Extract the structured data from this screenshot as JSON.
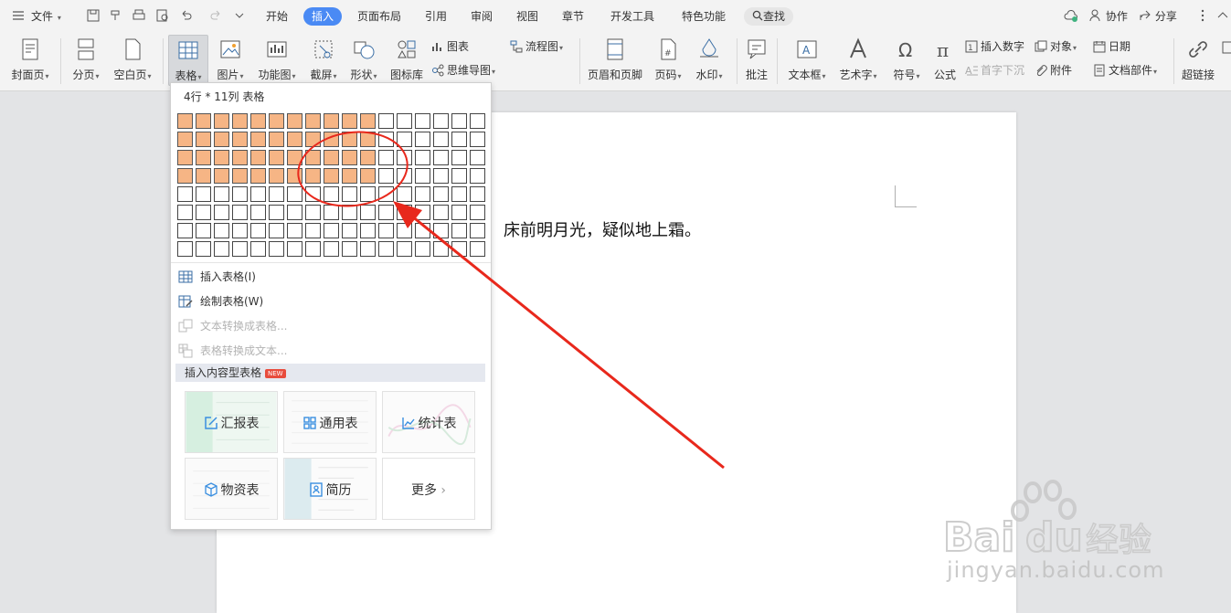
{
  "menubar": {
    "file_label": "文件",
    "tabs": [
      "开始",
      "插入",
      "页面布局",
      "引用",
      "审阅",
      "视图",
      "章节",
      "开发工具",
      "特色功能"
    ],
    "active_tab": "插入",
    "search_label": "查找",
    "collab_label": "协作",
    "share_label": "分享"
  },
  "ribbon": {
    "cover_page": "封面页",
    "page_break": "分页",
    "blank_page": "空白页",
    "table": "表格",
    "picture": "图片",
    "function_chart": "功能图",
    "screenshot": "截屏",
    "shape": "形状",
    "icon_lib": "图标库",
    "chart": "图表",
    "mind_map": "思维导图",
    "flowchart": "流程图",
    "header_footer": "页眉和页脚",
    "page_number": "页码",
    "watermark": "水印",
    "comment": "批注",
    "text_box": "文本框",
    "word_art": "艺术字",
    "symbol": "符号",
    "formula": "公式",
    "insert_number": "插入数字",
    "drop_cap": "首字下沉",
    "object": "对象",
    "attachment": "附件",
    "date": "日期",
    "doc_parts": "文档部件",
    "hyperlink": "超链接"
  },
  "table_dropdown": {
    "size_label": "4行 * 11列 表格",
    "grid_rows": 8,
    "grid_cols": 17,
    "selected_rows": 4,
    "selected_cols": 11,
    "items": [
      {
        "label": "插入表格(I)",
        "enabled": true
      },
      {
        "label": "绘制表格(W)",
        "enabled": true
      },
      {
        "label": "文本转换成表格...",
        "enabled": false
      },
      {
        "label": "表格转换成文本...",
        "enabled": false
      }
    ],
    "section_label": "插入内容型表格",
    "new_badge": "NEW",
    "templates": [
      "汇报表",
      "通用表",
      "统计表",
      "物资表",
      "简历",
      "更多"
    ]
  },
  "document": {
    "text": "床前明月光，疑似地上霜。"
  },
  "watermark": {
    "text": "jingyan.baidu.com"
  },
  "colors": {
    "accent": "#4a8af4",
    "cell_selected": "#f6b585",
    "annotation": "#e8281c"
  }
}
